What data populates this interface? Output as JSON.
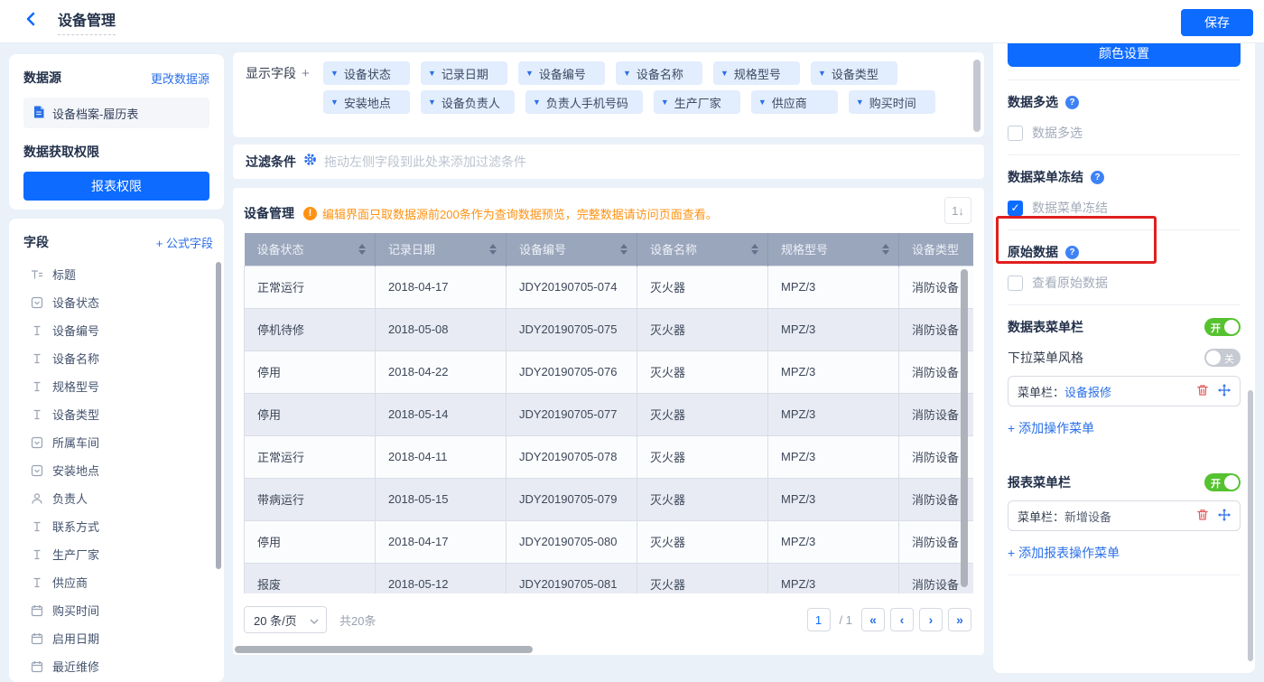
{
  "topbar": {
    "title": "设备管理",
    "save_label": "保存"
  },
  "datasource_panel": {
    "title": "数据源",
    "change_link": "更改数据源",
    "source_name": "设备档案-履历表",
    "permission_title": "数据获取权限",
    "permission_button": "报表权限"
  },
  "fields_panel": {
    "title": "字段",
    "formula_link": "+ 公式字段",
    "items": [
      {
        "icon": "title",
        "label": "标题"
      },
      {
        "icon": "select",
        "label": "设备状态"
      },
      {
        "icon": "text",
        "label": "设备编号"
      },
      {
        "icon": "text",
        "label": "设备名称"
      },
      {
        "icon": "text",
        "label": "规格型号"
      },
      {
        "icon": "text",
        "label": "设备类型"
      },
      {
        "icon": "select",
        "label": "所属车间"
      },
      {
        "icon": "select",
        "label": "安装地点"
      },
      {
        "icon": "user",
        "label": "负责人"
      },
      {
        "icon": "text",
        "label": "联系方式"
      },
      {
        "icon": "text",
        "label": "生产厂家"
      },
      {
        "icon": "text",
        "label": "供应商"
      },
      {
        "icon": "date",
        "label": "购买时间"
      },
      {
        "icon": "date",
        "label": "启用日期"
      },
      {
        "icon": "date",
        "label": "最近维修"
      }
    ]
  },
  "display_fields": {
    "label": "显示字段",
    "add": "+",
    "chips": [
      "设备状态",
      "记录日期",
      "设备编号",
      "设备名称",
      "规格型号",
      "设备类型",
      "安装地点",
      "设备负责人",
      "负责人手机号码",
      "生产厂家",
      "供应商",
      "购买时间"
    ]
  },
  "filter": {
    "label": "过滤条件",
    "placeholder": "拖动左侧字段到此处来添加过滤条件"
  },
  "table_panel": {
    "title": "设备管理",
    "warning": "编辑界面只取数据源前200条作为查询数据预览，完整数据请访问页面查看。",
    "sort_tool": "1↓",
    "columns": [
      "设备状态",
      "记录日期",
      "设备编号",
      "设备名称",
      "规格型号",
      "设备类型"
    ],
    "rows": [
      [
        "正常运行",
        "2018-04-17",
        "JDY20190705-074",
        "灭火器",
        "MPZ/3",
        "消防设备"
      ],
      [
        "停机待修",
        "2018-05-08",
        "JDY20190705-075",
        "灭火器",
        "MPZ/3",
        "消防设备"
      ],
      [
        "停用",
        "2018-04-22",
        "JDY20190705-076",
        "灭火器",
        "MPZ/3",
        "消防设备"
      ],
      [
        "停用",
        "2018-05-14",
        "JDY20190705-077",
        "灭火器",
        "MPZ/3",
        "消防设备"
      ],
      [
        "正常运行",
        "2018-04-11",
        "JDY20190705-078",
        "灭火器",
        "MPZ/3",
        "消防设备"
      ],
      [
        "带病运行",
        "2018-05-15",
        "JDY20190705-079",
        "灭火器",
        "MPZ/3",
        "消防设备"
      ],
      [
        "停用",
        "2018-04-17",
        "JDY20190705-080",
        "灭火器",
        "MPZ/3",
        "消防设备"
      ],
      [
        "报废",
        "2018-05-12",
        "JDY20190705-081",
        "灭火器",
        "MPZ/3",
        "消防设备"
      ]
    ],
    "pagination": {
      "page_size": "20 条/页",
      "total": "共20条",
      "page": "1",
      "page_total": "/ 1",
      "first": "«",
      "prev": "‹",
      "next": "›",
      "last": "»"
    }
  },
  "settings_panel": {
    "color_button": "颜色设置",
    "multi_select": {
      "title": "数据多选",
      "checkbox_label": "数据多选",
      "checked": false
    },
    "menu_freeze": {
      "title": "数据菜单冻结",
      "checkbox_label": "数据菜单冻结",
      "checked": true
    },
    "raw_data": {
      "title": "原始数据",
      "checkbox_label": "查看原始数据",
      "checked": false
    },
    "data_table_menu": {
      "title": "数据表菜单栏",
      "toggle_state": "开",
      "dropdown_style_label": "下拉菜单风格",
      "dropdown_toggle_state": "关",
      "menu_item_prefix": "菜单栏：",
      "menu_item_name": "设备报修",
      "add_link": "+ 添加操作菜单"
    },
    "report_menu": {
      "title": "报表菜单栏",
      "toggle_state": "开",
      "menu_item_prefix": "菜单栏：",
      "menu_item_name": "新增设备",
      "add_link": "+ 添加报表操作菜单"
    },
    "colors": {
      "primary": "#0d6bff",
      "toggle_on": "#56c230",
      "highlight": "#e01f1f",
      "warning": "#ff9213"
    }
  }
}
